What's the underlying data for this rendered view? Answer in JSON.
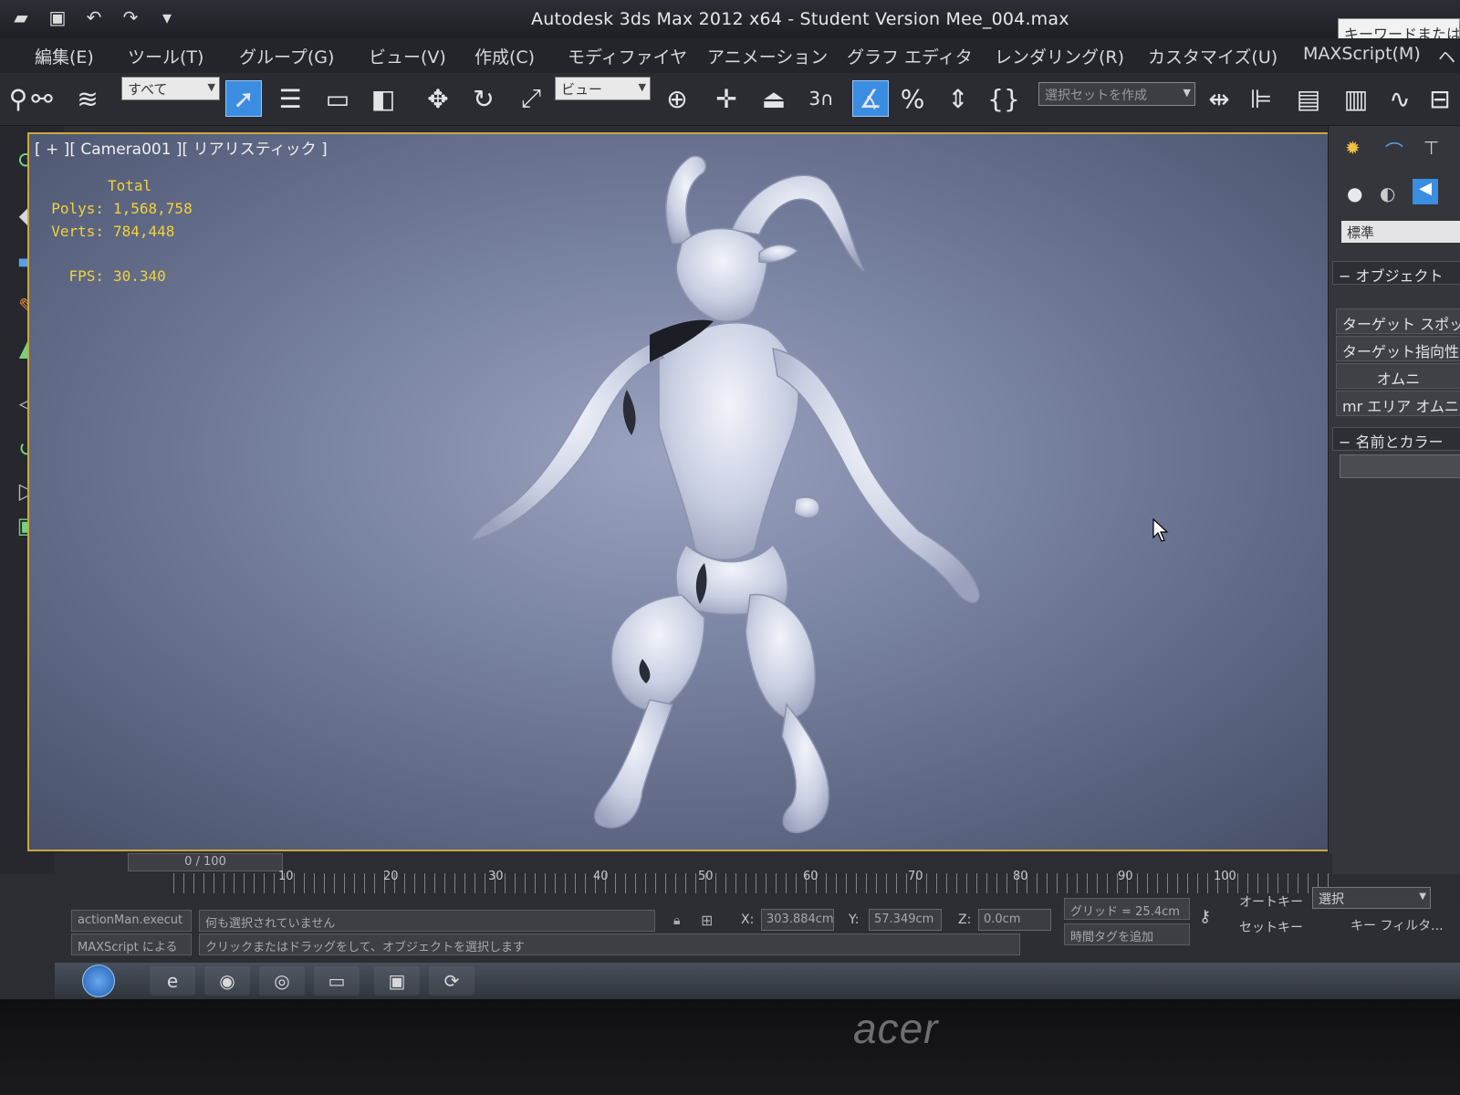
{
  "titlebar": {
    "title": "Autodesk 3ds Max  2012 x64  - Student Version   Mee_004.max",
    "search_placeholder": "キーワードまたは語"
  },
  "menu": [
    "編集(E)",
    "ツール(T)",
    "グループ(G)",
    "ビュー(V)",
    "作成(C)",
    "モディファイヤ",
    "アニメーション",
    "グラフ エディタ",
    "レンダリング(R)",
    "カスタマイズ(U)",
    "MAXScript(M)",
    "ヘ"
  ],
  "toolbar": {
    "filter_dropdown": "すべて",
    "refcoord_dropdown": "ビュー",
    "selection_set": "選択セットを作成",
    "snap_label": "3"
  },
  "viewport": {
    "label": "[ + ][ Camera001 ][ リアリスティック ]",
    "stats": {
      "total_label": "Total",
      "polys_label": "Polys:",
      "polys_value": "1,568,758",
      "verts_label": "Verts:",
      "verts_value": "784,448",
      "fps_label": "FPS:",
      "fps_value": "30.340"
    }
  },
  "command_panel": {
    "dropdown": "標準",
    "rollout_object_type": "オブジェクト",
    "buttons": [
      "ターゲット スポット",
      "ターゲット指向性",
      "オムニ",
      "mr エリア オムニ"
    ],
    "rollout_name_color": "名前とカラー"
  },
  "timeline": {
    "frame_display": "0 / 100",
    "ticks": [
      "10",
      "20",
      "30",
      "40",
      "50",
      "60",
      "70",
      "80",
      "90",
      "100"
    ]
  },
  "status": {
    "listener_1": "actionMan.execut",
    "listener_2": "MAXScript による",
    "prompt_1": "何も選択されていません",
    "prompt_2": "クリックまたはドラッグをして、オブジェクトを選択します",
    "x_label": "X:",
    "x_value": "303.884cm",
    "y_label": "Y:",
    "y_value": "57.349cm",
    "z_label": "Z:",
    "z_value": "0.0cm",
    "grid": "グリッド = 25.4cm",
    "add_time_tag": "時間タグを追加",
    "auto_key": "オートキー",
    "set_key": "セットキー",
    "selection_dropdown": "選択",
    "key_filter": "キー フィルタ..."
  },
  "bezel": {
    "brand": "acer"
  },
  "colors": {
    "viewport_border": "#c9a83c",
    "stats_text": "#f2d23a",
    "active_tool": "#3a8de0"
  }
}
